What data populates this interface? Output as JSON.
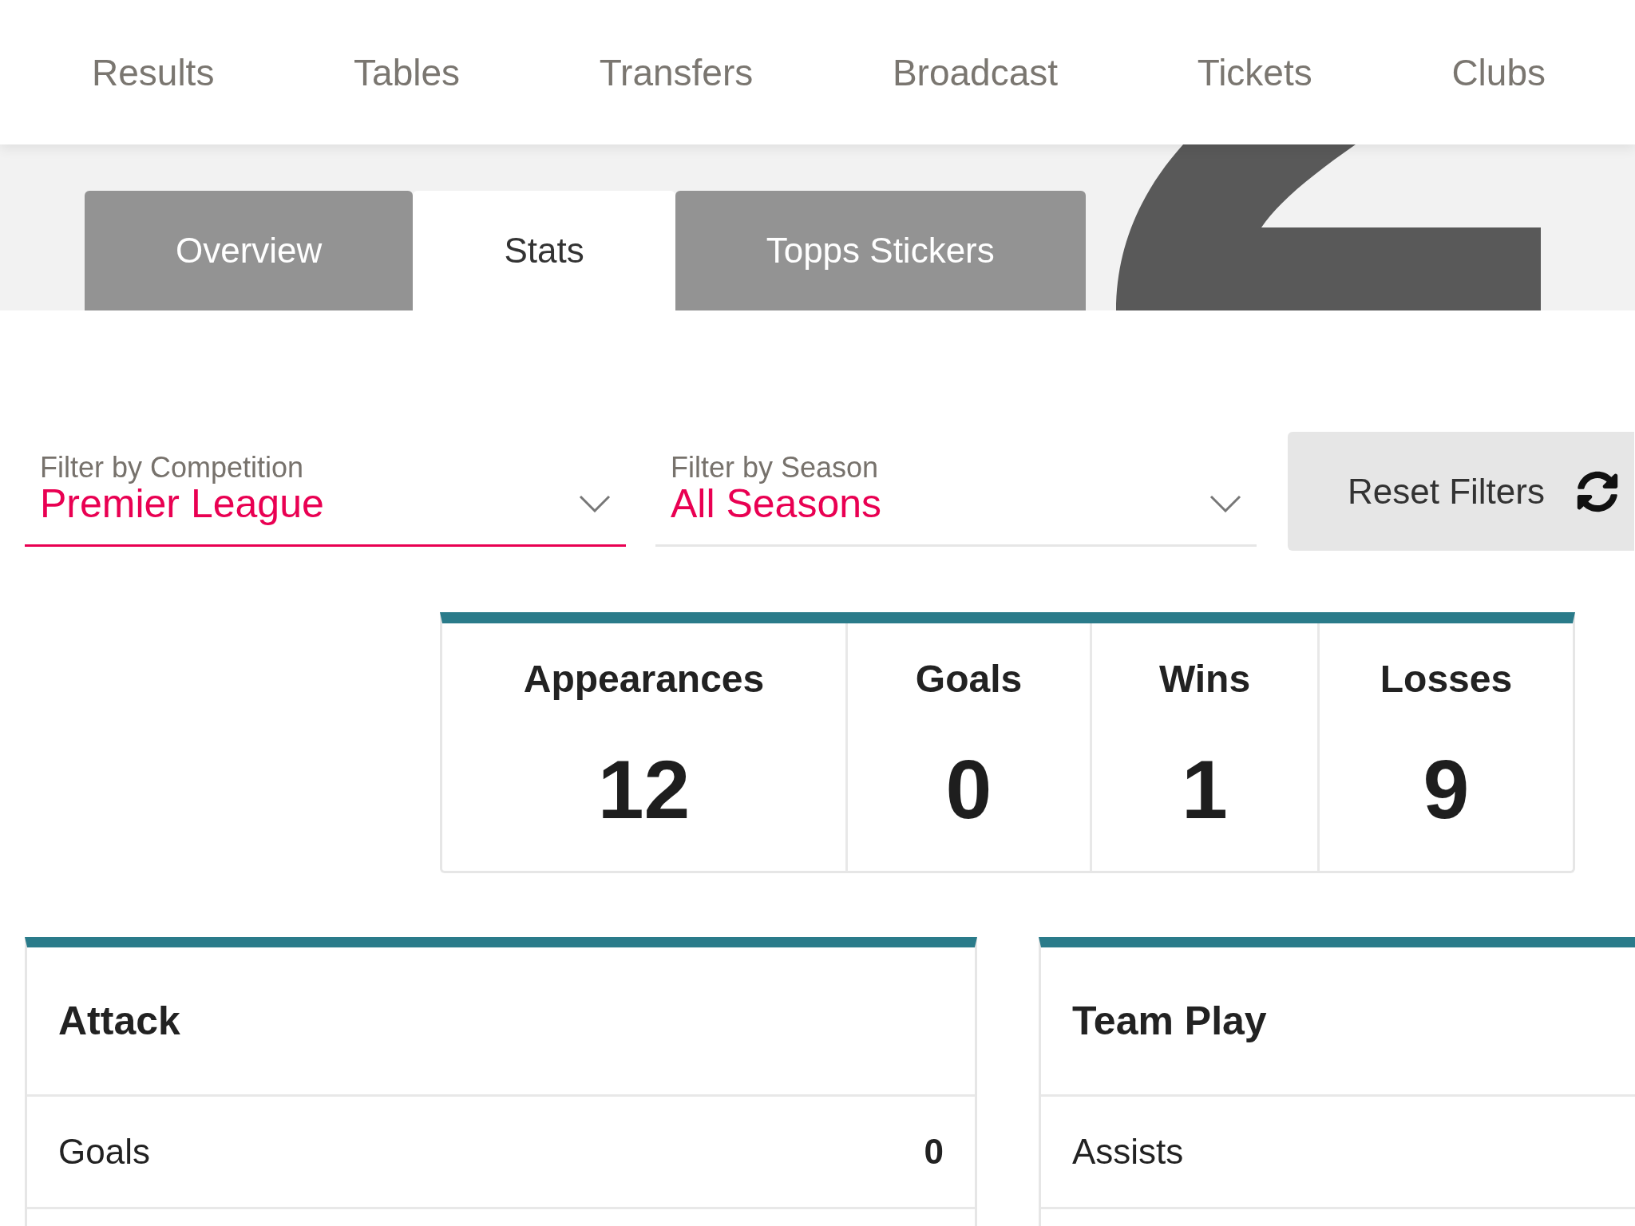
{
  "nav": {
    "links": [
      "Results",
      "Tables",
      "Transfers",
      "Broadcast",
      "Tickets",
      "Clubs"
    ]
  },
  "tabs": [
    {
      "label": "Overview",
      "selected": false
    },
    {
      "label": "Stats",
      "selected": true
    },
    {
      "label": "Topps Stickers",
      "selected": false
    }
  ],
  "filters": [
    {
      "label": "Filter by Competition",
      "value": "Premier League",
      "focused": true
    },
    {
      "label": "Filter by Season",
      "value": "All Seasons",
      "focused": false
    }
  ],
  "reset_button": {
    "label": "Reset Filters"
  },
  "summary": [
    {
      "label": "Appearances",
      "value": "12"
    },
    {
      "label": "Goals",
      "value": "0"
    },
    {
      "label": "Wins",
      "value": "1"
    },
    {
      "label": "Losses",
      "value": "9"
    }
  ],
  "panels": [
    {
      "title": "Attack",
      "rows": [
        {
          "label": "Goals",
          "value": "0"
        }
      ]
    },
    {
      "title": "Team Play",
      "rows": [
        {
          "label": "Assists"
        }
      ]
    }
  ]
}
